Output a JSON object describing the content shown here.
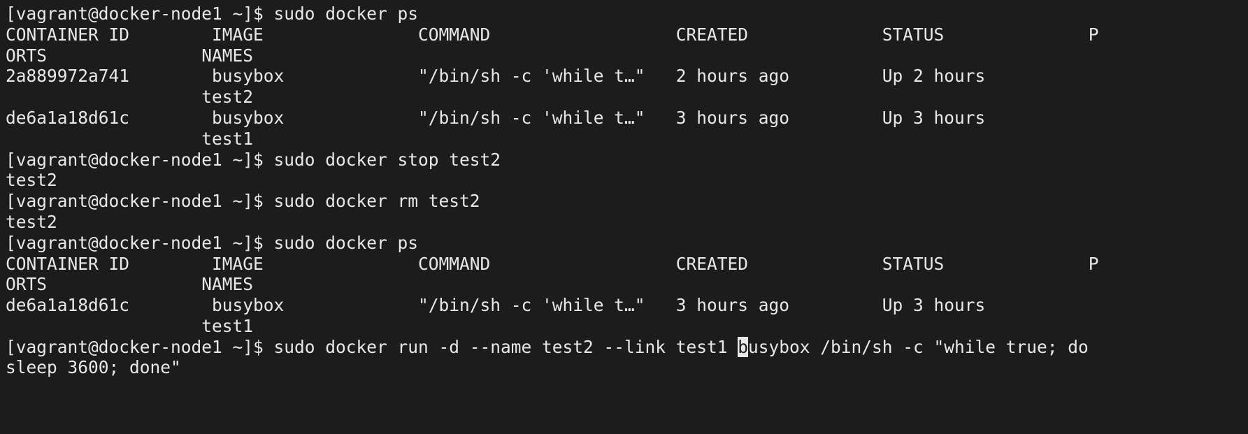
{
  "terminal": {
    "lines": [
      "[vagrant@docker-node1 ~]$ sudo docker ps",
      "CONTAINER ID        IMAGE               COMMAND                  CREATED             STATUS              P",
      "ORTS               NAMES",
      "2a889972a741        busybox             \"/bin/sh -c 'while t…\"   2 hours ago         Up 2 hours",
      "                   test2",
      "de6a1a18d61c        busybox             \"/bin/sh -c 'while t…\"   3 hours ago         Up 3 hours",
      "                   test1",
      "[vagrant@docker-node1 ~]$ sudo docker stop test2",
      "test2",
      "[vagrant@docker-node1 ~]$ sudo docker rm test2",
      "test2",
      "[vagrant@docker-node1 ~]$ sudo docker ps",
      "CONTAINER ID        IMAGE               COMMAND                  CREATED             STATUS              P",
      "ORTS               NAMES",
      "de6a1a18d61c        busybox             \"/bin/sh -c 'while t…\"   3 hours ago         Up 3 hours",
      "                   test1"
    ],
    "current_line": {
      "before_cursor": "[vagrant@docker-node1 ~]$ sudo docker run -d --name test2 --link test1 ",
      "cursor_char": "b",
      "after_cursor": "usybox /bin/sh -c \"while true; do"
    },
    "continuation_line": "sleep 3600; done\""
  }
}
